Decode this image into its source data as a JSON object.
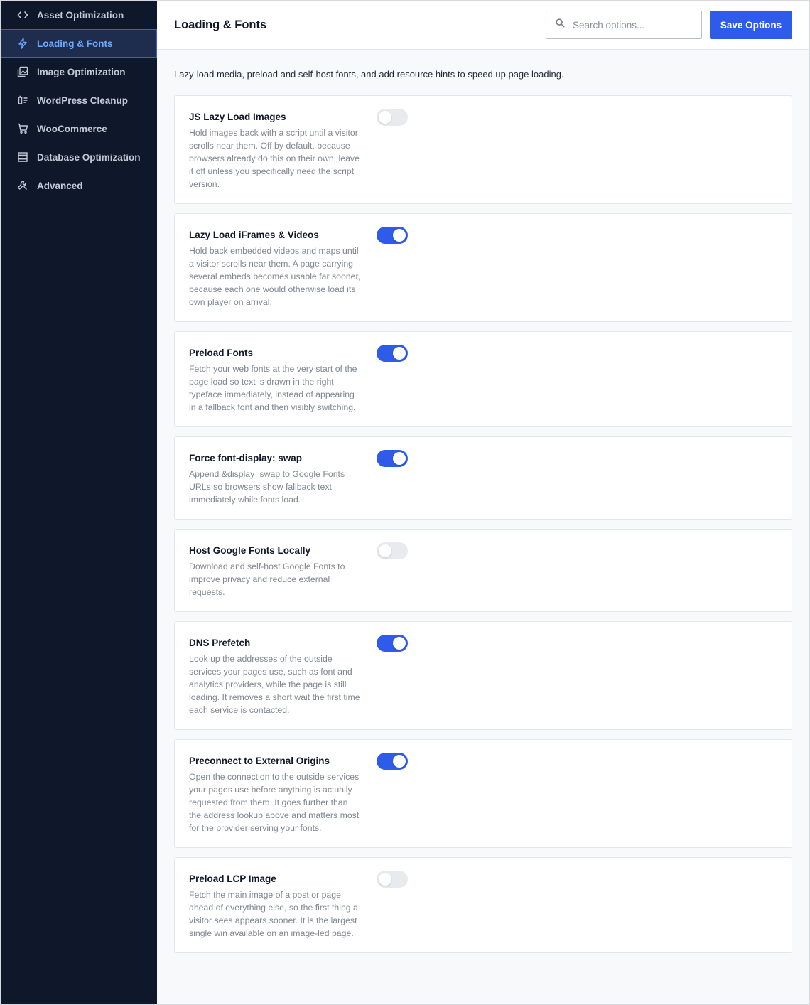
{
  "sidebar": {
    "items": [
      {
        "label": "Asset Optimization",
        "icon": "code-icon",
        "active": false
      },
      {
        "label": "Loading & Fonts",
        "icon": "lightning-icon",
        "active": true
      },
      {
        "label": "Image Optimization",
        "icon": "image-icon",
        "active": false
      },
      {
        "label": "WordPress Cleanup",
        "icon": "trash-list-icon",
        "active": false
      },
      {
        "label": "WooCommerce",
        "icon": "cart-icon",
        "active": false
      },
      {
        "label": "Database Optimization",
        "icon": "database-icon",
        "active": false
      },
      {
        "label": "Advanced",
        "icon": "wrench-icon",
        "active": false
      }
    ]
  },
  "header": {
    "title": "Loading & Fonts",
    "search_placeholder": "Search options...",
    "save_label": "Save Options"
  },
  "main": {
    "description": "Lazy-load media, preload and self-host fonts, and add resource hints to speed up page loading.",
    "options": [
      {
        "title": "JS Lazy Load Images",
        "description": "Hold images back with a script until a visitor scrolls near them. Off by default, because browsers already do this on their own; leave it off unless you specifically need the script version.",
        "enabled": false
      },
      {
        "title": "Lazy Load iFrames & Videos",
        "description": "Hold back embedded videos and maps until a visitor scrolls near them. A page carrying several embeds becomes usable far sooner, because each one would otherwise load its own player on arrival.",
        "enabled": true
      },
      {
        "title": "Preload Fonts",
        "description": "Fetch your web fonts at the very start of the page load so text is drawn in the right typeface immediately, instead of appearing in a fallback font and then visibly switching.",
        "enabled": true
      },
      {
        "title": "Force font-display: swap",
        "description": "Append &display=swap to Google Fonts URLs so browsers show fallback text immediately while fonts load.",
        "enabled": true
      },
      {
        "title": "Host Google Fonts Locally",
        "description": "Download and self-host Google Fonts to improve privacy and reduce external requests.",
        "enabled": false
      },
      {
        "title": "DNS Prefetch",
        "description": "Look up the addresses of the outside services your pages use, such as font and analytics providers, while the page is still loading. It removes a short wait the first time each service is contacted.",
        "enabled": true
      },
      {
        "title": "Preconnect to External Origins",
        "description": "Open the connection to the outside services your pages use before anything is actually requested from them. It goes further than the address lookup above and matters most for the provider serving your fonts.",
        "enabled": true
      },
      {
        "title": "Preload LCP Image",
        "description": "Fetch the main image of a post or page ahead of everything else, so the first thing a visitor sees appears sooner. It is the largest single win available on an image-led page.",
        "enabled": false
      }
    ]
  },
  "colors": {
    "sidebar_bg": "#0f172a",
    "accent": "#2f5bea",
    "active_text": "#6ea8ff"
  }
}
